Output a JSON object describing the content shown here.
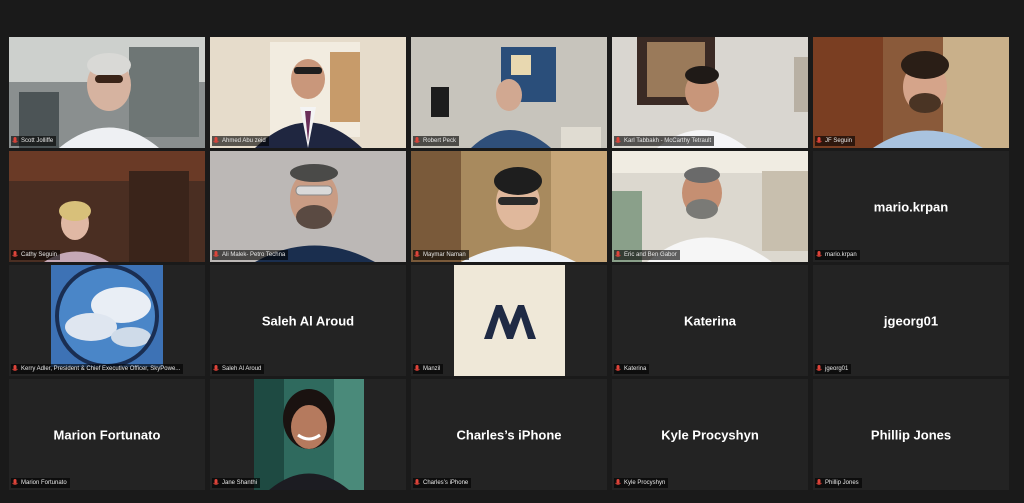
{
  "participants": [
    {
      "name": "Scott Jolliffe",
      "center": ""
    },
    {
      "name": "Ahmed Abu zeid",
      "center": ""
    },
    {
      "name": "Robert Peck",
      "center": ""
    },
    {
      "name": "Karl Tabbakh - McCarthy Tetrault",
      "center": ""
    },
    {
      "name": "JF Seguin",
      "center": ""
    },
    {
      "name": "Cathy Seguin",
      "center": ""
    },
    {
      "name": "Ali Malek- Petro Techna",
      "center": ""
    },
    {
      "name": "Maymar Naman",
      "center": ""
    },
    {
      "name": "Eric and Ben Gabor",
      "center": ""
    },
    {
      "name": "mario.krpan",
      "center": "mario.krpan"
    },
    {
      "name": "Kerry Adler, President & Chief Executive Officer, SkyPowe...",
      "center": ""
    },
    {
      "name": "Saleh Al Aroud",
      "center": "Saleh Al Aroud"
    },
    {
      "name": "Manzil",
      "center": ""
    },
    {
      "name": "Katerina",
      "center": "Katerina"
    },
    {
      "name": "jgeorg01",
      "center": "jgeorg01"
    },
    {
      "name": "Marion Fortunato",
      "center": "Marion Fortunato"
    },
    {
      "name": "Jane Shanthi",
      "center": ""
    },
    {
      "name": "Charles’s iPhone",
      "center": "Charles’s iPhone"
    },
    {
      "name": "Kyle Procyshyn",
      "center": "Kyle Procyshyn"
    },
    {
      "name": "Phillip Jones",
      "center": "Phillip Jones"
    }
  ],
  "colors": {
    "active_speaker_border": "#c8e06a",
    "tile_bg": "#232323",
    "muted_mic": "#e0443a"
  },
  "icons": {
    "muted": "mic-muted-icon"
  },
  "logo_text": "M"
}
